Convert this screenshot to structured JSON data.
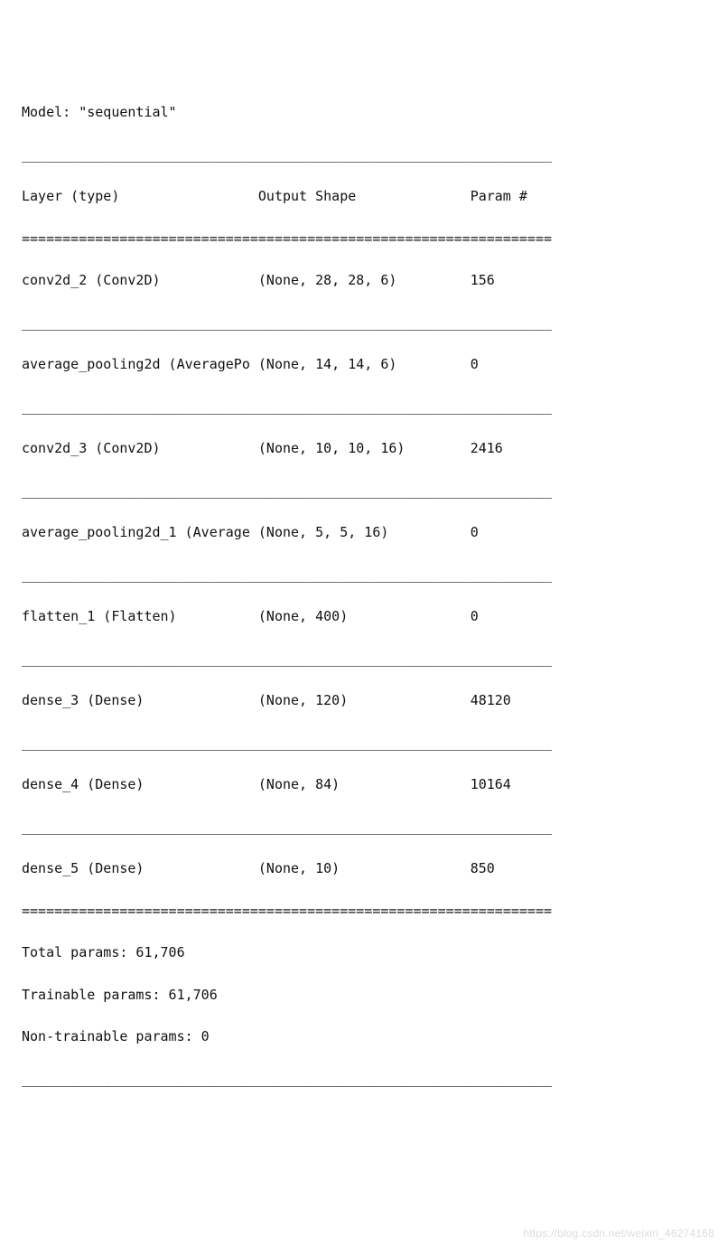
{
  "model_label": "Model: \"sequential\"",
  "sep_single": "_________________________________________________________________",
  "sep_double": "=================================================================",
  "header": {
    "c1": "Layer (type)",
    "c2": "Output Shape",
    "c3": "Param #"
  },
  "layers": [
    {
      "name": "conv2d_2 (Conv2D)",
      "shape": "(None, 28, 28, 6)",
      "params": "156"
    },
    {
      "name": "average_pooling2d (AveragePo",
      "shape": "(None, 14, 14, 6)",
      "params": "0"
    },
    {
      "name": "conv2d_3 (Conv2D)",
      "shape": "(None, 10, 10, 16)",
      "params": "2416"
    },
    {
      "name": "average_pooling2d_1 (Average",
      "shape": "(None, 5, 5, 16)",
      "params": "0"
    },
    {
      "name": "flatten_1 (Flatten)",
      "shape": "(None, 400)",
      "params": "0"
    },
    {
      "name": "dense_3 (Dense)",
      "shape": "(None, 120)",
      "params": "48120"
    },
    {
      "name": "dense_4 (Dense)",
      "shape": "(None, 84)",
      "params": "10164"
    },
    {
      "name": "dense_5 (Dense)",
      "shape": "(None, 10)",
      "params": "850"
    }
  ],
  "totals": {
    "total": "Total params: 61,706",
    "trainable": "Trainable params: 61,706",
    "nontrainable": "Non-trainable params: 0"
  },
  "watermark": "https://blog.csdn.net/weixin_46274168"
}
